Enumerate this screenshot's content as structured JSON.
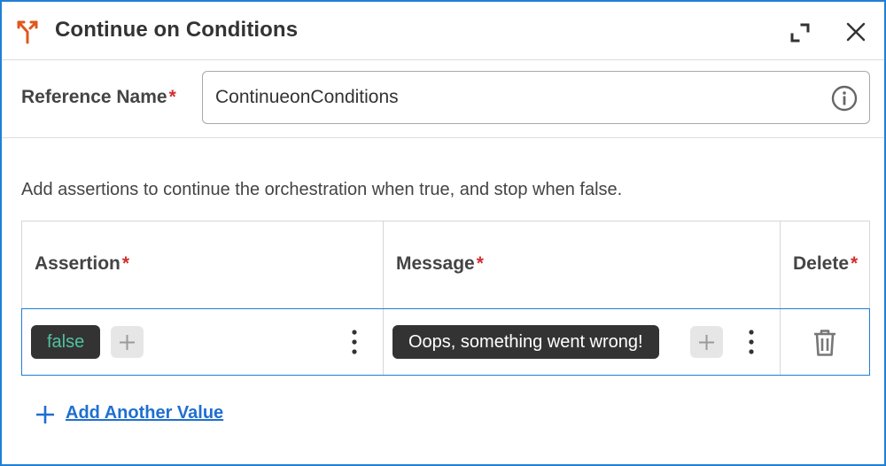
{
  "header": {
    "title": "Continue on Conditions",
    "accent": "#e0571f"
  },
  "reference": {
    "label": "Reference Name",
    "required_mark": "*",
    "value": "ContinueonConditions"
  },
  "description": "Add assertions to continue the orchestration when true, and stop when false.",
  "table": {
    "columns": [
      {
        "label": "Assertion",
        "required_mark": "*"
      },
      {
        "label": "Message",
        "required_mark": "*"
      },
      {
        "label": "Delete",
        "required_mark": "*"
      }
    ],
    "rows": [
      {
        "assertion": "false",
        "message": "Oops, something went wrong!"
      }
    ]
  },
  "add_value_label": "Add Another Value",
  "colors": {
    "border_accent": "#1f7fd6",
    "link": "#1f6fd0",
    "required": "#d32f2f",
    "bool_text": "#4fc3a1"
  }
}
